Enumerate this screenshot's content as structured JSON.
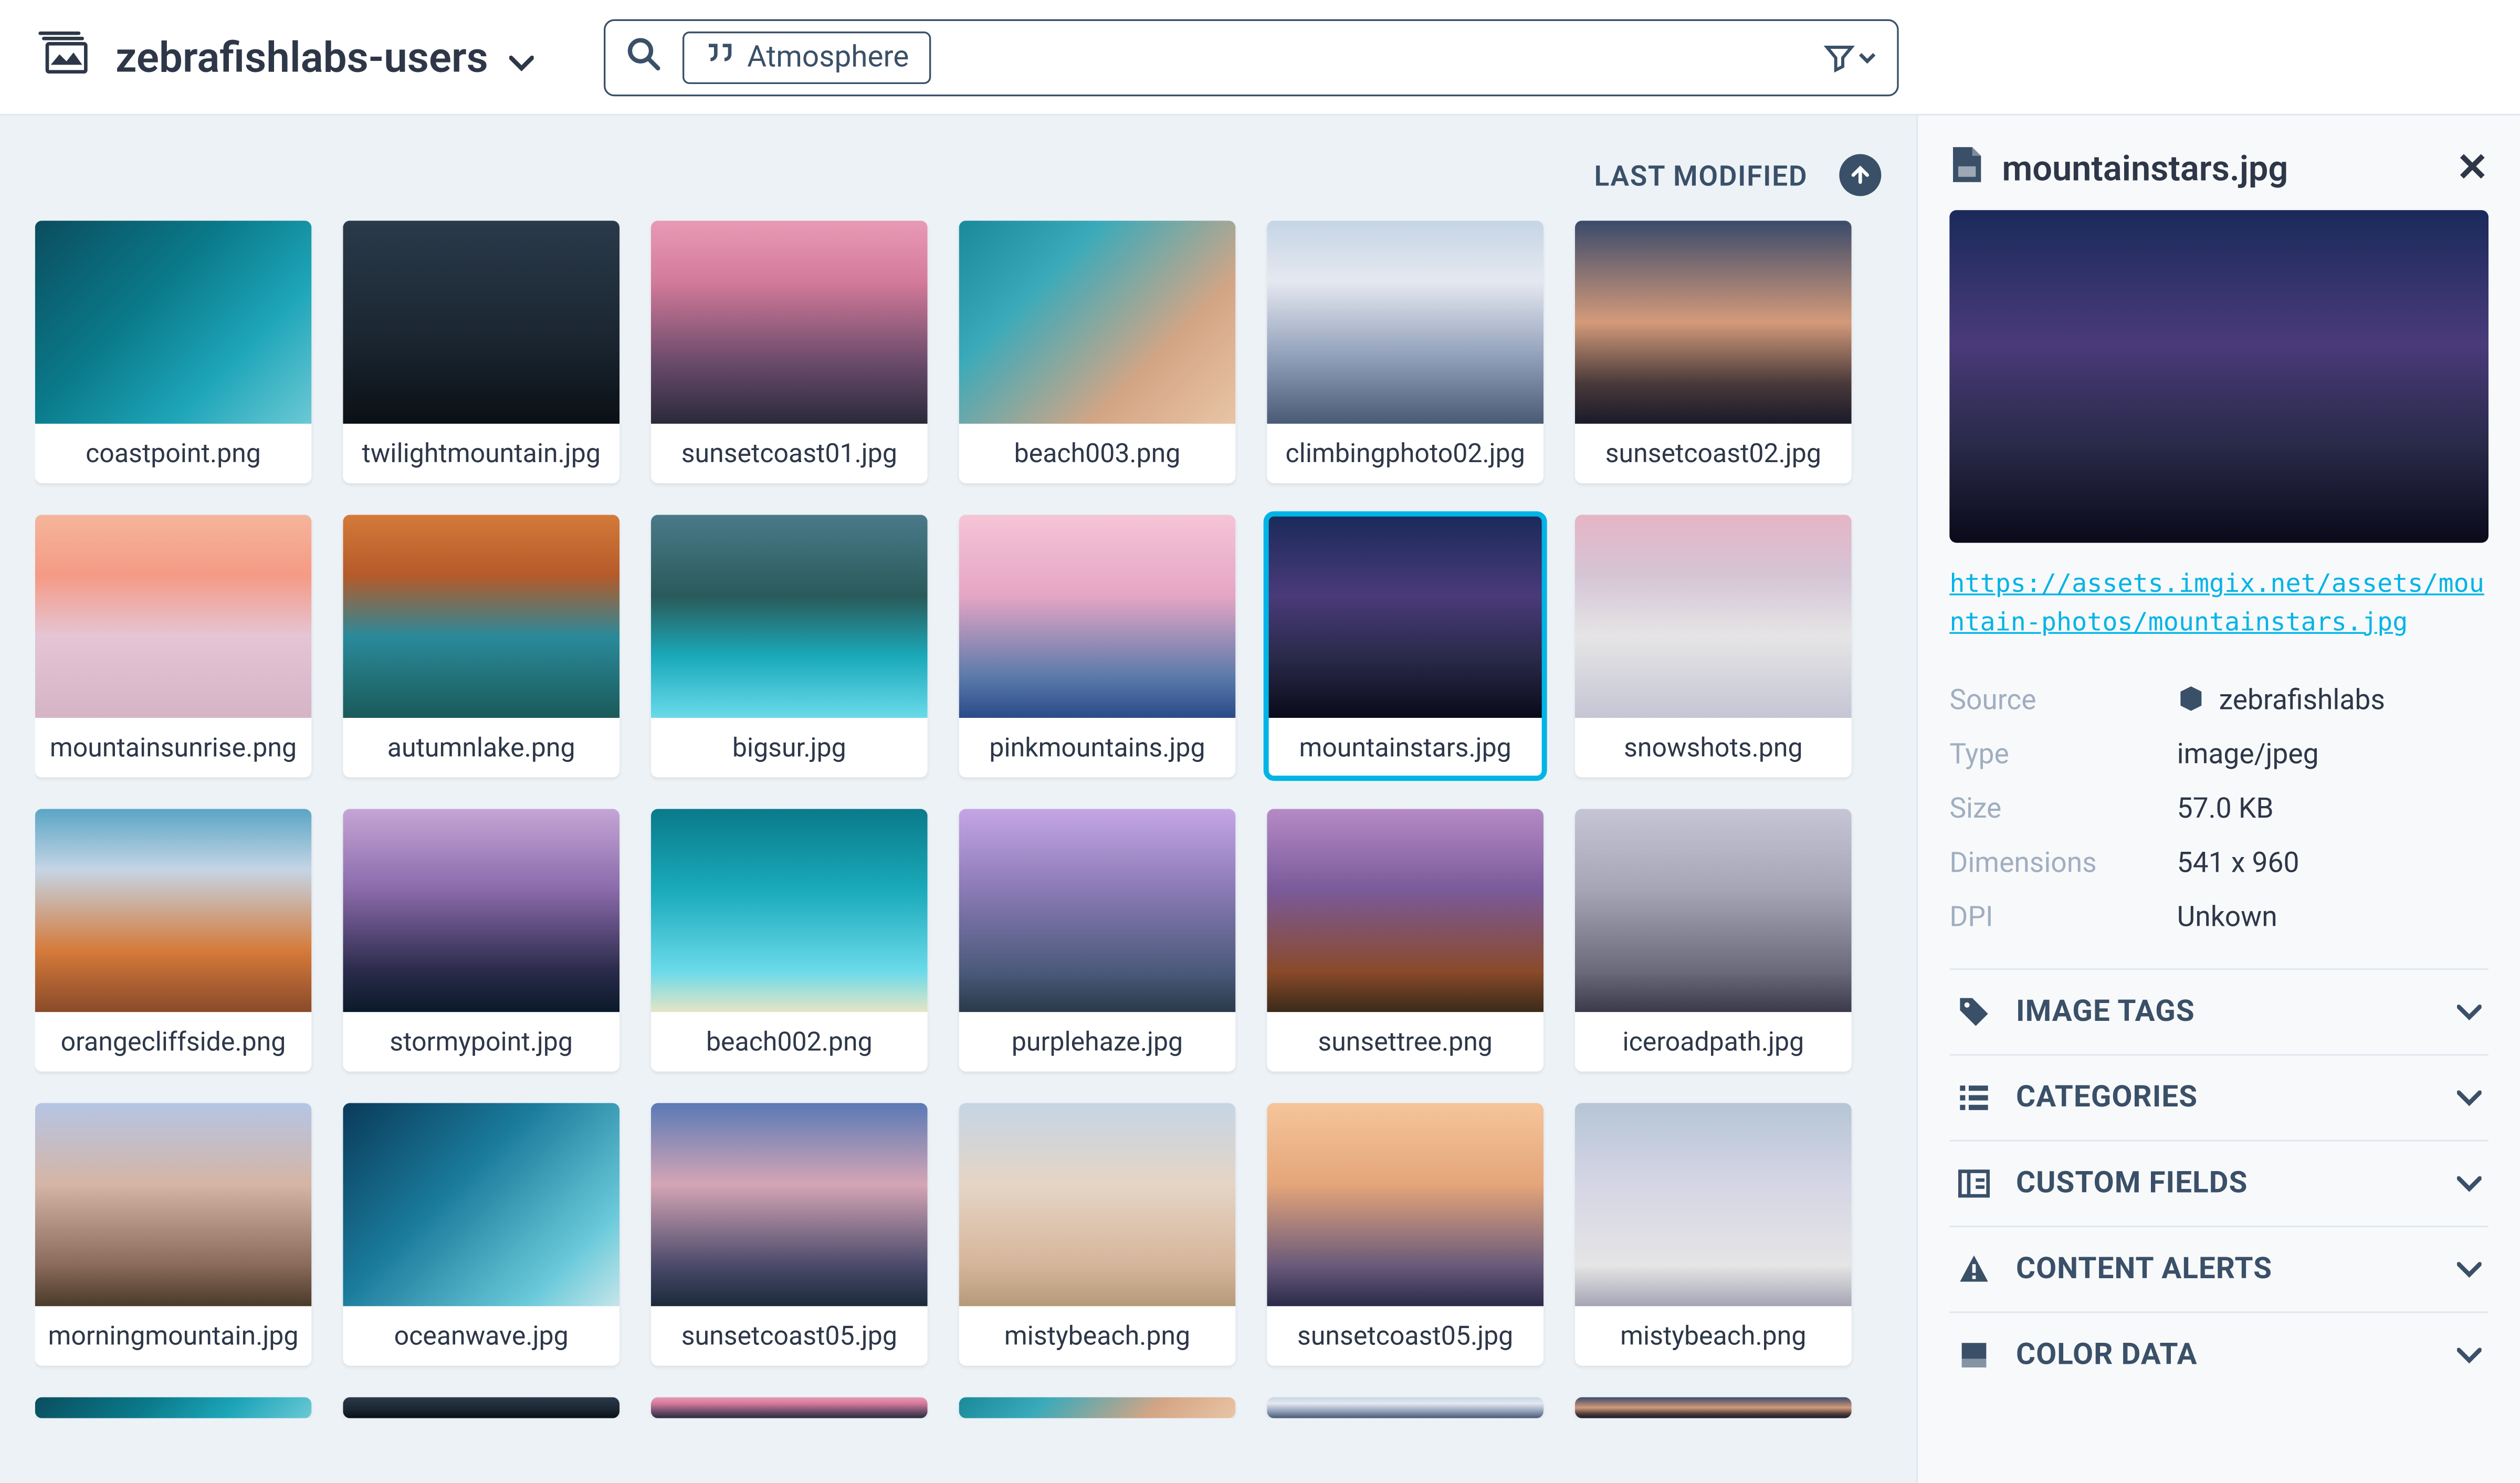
{
  "header": {
    "workspace": "zebrafishlabs-users",
    "search_tag": "Atmosphere"
  },
  "sort": {
    "label": "LAST MODIFIED"
  },
  "assets": [
    {
      "name": "coastpoint.png",
      "css": "g-ocean1"
    },
    {
      "name": "twilightmountain.jpg",
      "css": "g-twilight"
    },
    {
      "name": "sunsetcoast01.jpg",
      "css": "g-sunset1"
    },
    {
      "name": "beach003.png",
      "css": "g-beach3"
    },
    {
      "name": "climbingphoto02.jpg",
      "css": "g-climb"
    },
    {
      "name": "sunsetcoast02.jpg",
      "css": "g-sunset2"
    },
    {
      "name": "mountainsunrise.png",
      "css": "g-sunrise"
    },
    {
      "name": "autumnlake.png",
      "css": "g-autumn"
    },
    {
      "name": "bigsur.jpg",
      "css": "g-bigsur"
    },
    {
      "name": "pinkmountains.jpg",
      "css": "g-pink"
    },
    {
      "name": "mountainstars.jpg",
      "css": "g-stars",
      "selected": true
    },
    {
      "name": "snowshots.png",
      "css": "g-snow"
    },
    {
      "name": "orangecliffside.png",
      "css": "g-orange"
    },
    {
      "name": "stormypoint.jpg",
      "css": "g-stormy"
    },
    {
      "name": "beach002.png",
      "css": "g-beach2"
    },
    {
      "name": "purplehaze.jpg",
      "css": "g-purple"
    },
    {
      "name": "sunsettree.png",
      "css": "g-tree"
    },
    {
      "name": "iceroadpath.jpg",
      "css": "g-ice"
    },
    {
      "name": "morningmountain.jpg",
      "css": "g-morning"
    },
    {
      "name": "oceanwave.jpg",
      "css": "g-wave"
    },
    {
      "name": "sunsetcoast05.jpg",
      "css": "g-sunset5a"
    },
    {
      "name": "mistybeach.png",
      "css": "g-misty"
    },
    {
      "name": "sunsetcoast05.jpg",
      "css": "g-sunset5b"
    },
    {
      "name": "mistybeach.png",
      "css": "g-misty2"
    },
    {
      "name": "",
      "css": "g-ocean1",
      "partial": true
    },
    {
      "name": "",
      "css": "g-twilight",
      "partial": true
    },
    {
      "name": "",
      "css": "g-sunset1",
      "partial": true
    },
    {
      "name": "",
      "css": "g-beach3",
      "partial": true
    },
    {
      "name": "",
      "css": "g-climb",
      "partial": true
    },
    {
      "name": "",
      "css": "g-sunset2",
      "partial": true
    }
  ],
  "details": {
    "filename": "mountainstars.jpg",
    "url": "https://assets.imgix.net/assets/mountain-photos/mountainstars.jpg",
    "meta": {
      "source_label": "Source",
      "source_value": "zebrafishlabs",
      "type_label": "Type",
      "type_value": "image/jpeg",
      "size_label": "Size",
      "size_value": "57.0 KB",
      "dimensions_label": "Dimensions",
      "dimensions_value": "541 x 960",
      "dpi_label": "DPI",
      "dpi_value": "Unkown"
    },
    "sections": [
      {
        "label": "IMAGE TAGS",
        "icon": "tag"
      },
      {
        "label": "CATEGORIES",
        "icon": "list"
      },
      {
        "label": "CUSTOM FIELDS",
        "icon": "fields"
      },
      {
        "label": "CONTENT ALERTS",
        "icon": "alert"
      },
      {
        "label": "COLOR DATA",
        "icon": "swatch"
      }
    ]
  }
}
